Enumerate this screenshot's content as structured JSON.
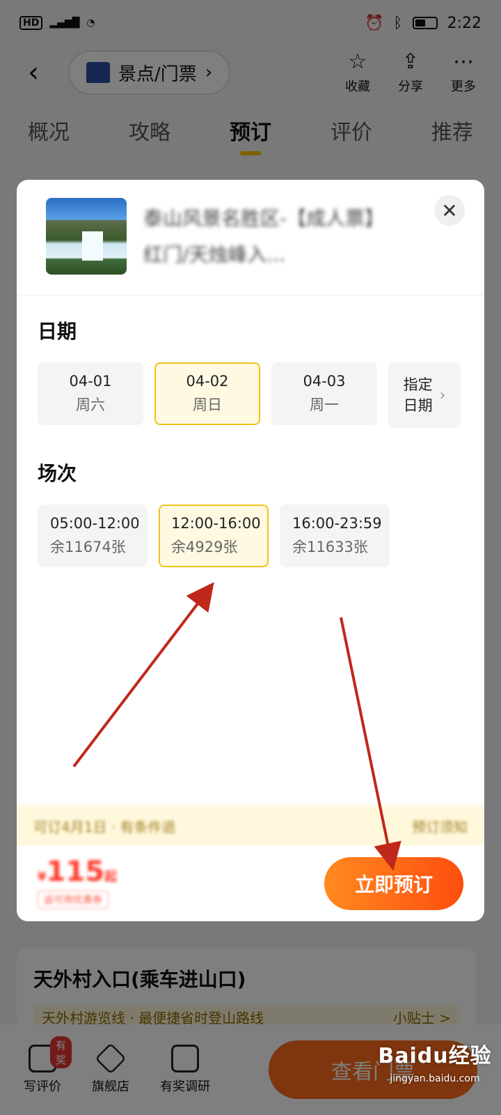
{
  "status_bar": {
    "network_left": "HD",
    "time": "2:22"
  },
  "header": {
    "back_icon": "chevron-left-icon",
    "category": "景点/门票",
    "actions": [
      {
        "icon": "star-icon",
        "label": "收藏"
      },
      {
        "icon": "share-icon",
        "label": "分享"
      },
      {
        "icon": "more-icon",
        "label": "更多"
      }
    ]
  },
  "tabs": [
    "概况",
    "攻略",
    "预订",
    "评价",
    "推荐"
  ],
  "active_tab": "预订",
  "modal": {
    "product_title": "泰山风景名胜区-【成人票】红门/天烛峰入...",
    "close_icon": "close-icon",
    "date_section_label": "日期",
    "dates": [
      {
        "date": "04-01",
        "weekday": "周六",
        "selected": false
      },
      {
        "date": "04-02",
        "weekday": "周日",
        "selected": true
      },
      {
        "date": "04-03",
        "weekday": "周一",
        "selected": false
      }
    ],
    "specify_date_line1": "指定",
    "specify_date_line2": "日期",
    "session_section_label": "场次",
    "sessions": [
      {
        "time": "05:00-12:00",
        "remaining": "余11674张",
        "selected": false
      },
      {
        "time": "12:00-16:00",
        "remaining": "余4929张",
        "selected": true
      },
      {
        "time": "16:00-23:59",
        "remaining": "余11633张",
        "selected": false
      }
    ],
    "notice_text": "可订4月1日 · 有条件退",
    "notice_right": "预订须知",
    "price_symbol": "¥",
    "price_value": "115",
    "price_suffix": "起",
    "price_tag": "返可用优惠券",
    "book_button": "立即预订"
  },
  "under_card": {
    "title": "天外村入口(乘车进山口)",
    "sub_left": "天外村游览线 · 最便捷省时登山路线",
    "sub_right": "小贴士 >"
  },
  "bottom_nav": [
    {
      "icon": "edit-icon",
      "label": "写评价",
      "badge": "有奖"
    },
    {
      "icon": "diamond-icon",
      "label": "旗舰店"
    },
    {
      "icon": "survey-icon",
      "label": "有奖调研"
    }
  ],
  "view_button": "查看门票",
  "watermark": {
    "logo_text": "Baidu经验",
    "url": "jingyan.baidu.com"
  },
  "colors": {
    "accent_yellow": "#f0c21a",
    "orange": "#ff5a14",
    "arrow_red": "#c0281c"
  }
}
